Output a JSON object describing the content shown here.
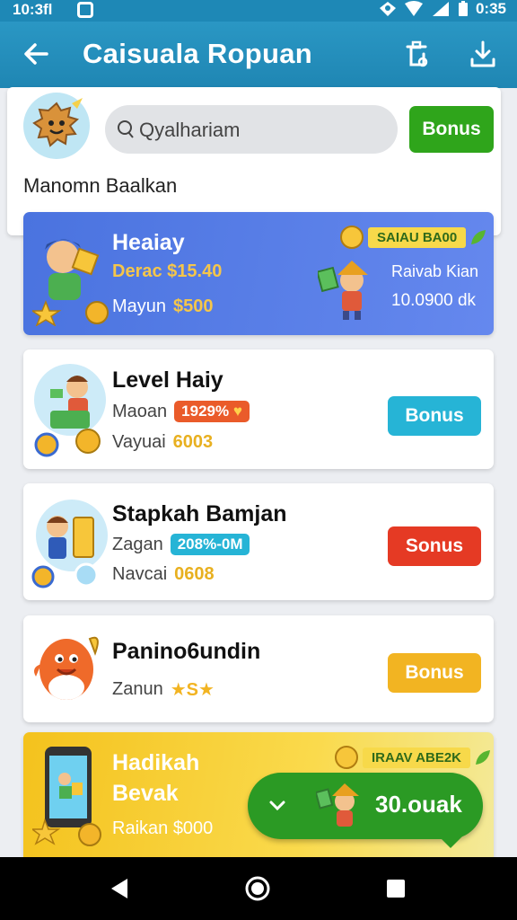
{
  "status_bar": {
    "time": "10:3ﬂ",
    "clock": "0:35"
  },
  "app_bar": {
    "title": "Caisuala Ropuan"
  },
  "profile": {
    "search_placeholder": "Qyalhariam",
    "bonus_label": "Bonus",
    "username": "Manomn Baalkan"
  },
  "cards": [
    {
      "title": "Heaiay",
      "line1": "Derac $15.40",
      "line2_label": "Mayun",
      "line2_value": "$500",
      "banner": "SAIAU BA00",
      "side_label": "Raivab Kian",
      "side_value": "10.0900 dk"
    },
    {
      "title": "Level Haiy",
      "line1_label": "Maoan",
      "line1_pill": "1929%",
      "line2_label": "Vayuai",
      "line2_value": "6003",
      "button": "Bonus"
    },
    {
      "title": "Stapkah Bamjan",
      "line1_label": "Zagan",
      "line1_pill": "208%-0M",
      "line2_label": "Navcai",
      "line2_value": "0608",
      "button": "Sonus"
    },
    {
      "title": "Panino6undin",
      "line1_label": "Zanun",
      "line1_stars": "★S★",
      "button": "Bonus"
    },
    {
      "title_line1": "Hadikah",
      "title_line2": "Bevak",
      "line3": "Raikan $000",
      "banner": "IRAAV ABE2K"
    }
  ],
  "popup": {
    "amount": "30.ouak"
  },
  "colors": {
    "app_bar": "#1f86b3",
    "bonus_green": "#2fa51b",
    "bonus_cyan": "#26b4d6",
    "bonus_red": "#e53a24",
    "bonus_orange": "#f2b422",
    "card_blue": "#5278e4",
    "card_yellow": "#f6c92a"
  }
}
